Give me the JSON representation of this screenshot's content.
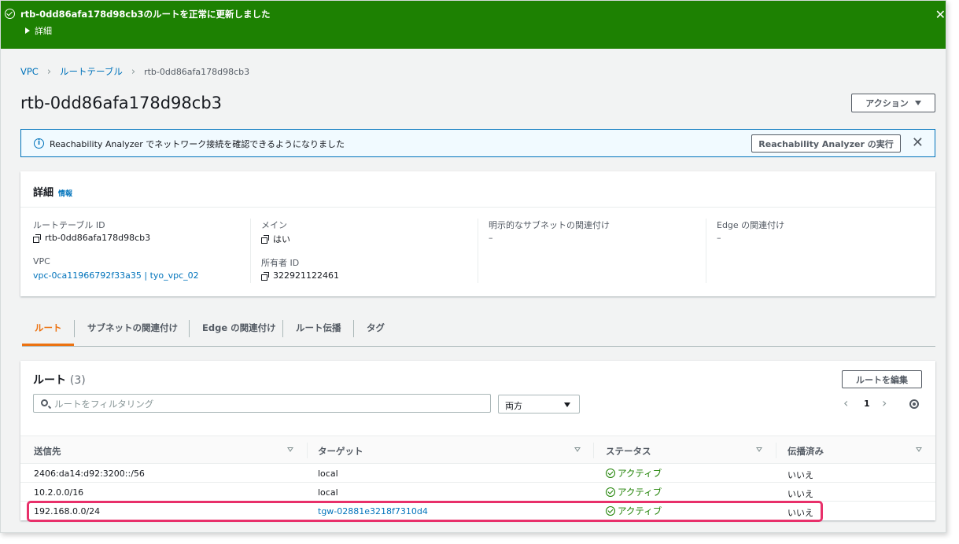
{
  "flash": {
    "message": "rtb-0dd86afa178d98cb3のルートを正常に更新しました",
    "details_label": "詳細",
    "close_glyph": "✕"
  },
  "breadcrumb": {
    "items": [
      "VPC",
      "ルートテーブル"
    ],
    "current": "rtb-0dd86afa178d98cb3"
  },
  "page": {
    "title": "rtb-0dd86afa178d98cb3",
    "actions_label": "アクション"
  },
  "reachability": {
    "message": "Reachability Analyzer でネットワーク接続を確認できるようになりました",
    "run_button": "Reachability Analyzer の実行"
  },
  "details": {
    "title": "詳細",
    "info_link": "情報",
    "fields": {
      "route_table_id_label": "ルートテーブル ID",
      "route_table_id": "rtb-0dd86afa178d98cb3",
      "vpc_label": "VPC",
      "vpc": "vpc-0ca11966792f33a35 | tyo_vpc_02",
      "main_label": "メイン",
      "main": "はい",
      "owner_label": "所有者 ID",
      "owner": "322921122461",
      "explicit_subnet_label": "明示的なサブネットの関連付け",
      "explicit_subnet": "–",
      "edge_label": "Edge の関連付け",
      "edge": "–"
    }
  },
  "tabs": [
    {
      "label": "ルート",
      "active": true
    },
    {
      "label": "サブネットの関連付け",
      "active": false
    },
    {
      "label": "Edge の関連付け",
      "active": false
    },
    {
      "label": "ルート伝播",
      "active": false
    },
    {
      "label": "タグ",
      "active": false
    }
  ],
  "routes": {
    "title": "ルート",
    "count": "(3)",
    "edit_button": "ルートを編集",
    "filter_placeholder": "ルートをフィルタリング",
    "direction_select": "両方",
    "page_number": "1",
    "columns": [
      "送信先",
      "ターゲット",
      "ステータス",
      "伝播済み"
    ],
    "rows": [
      {
        "destination": "2406:da14:d92:3200::/56",
        "target": "local",
        "target_link": false,
        "status": "アクティブ",
        "propagated": "いいえ"
      },
      {
        "destination": "10.2.0.0/16",
        "target": "local",
        "target_link": false,
        "status": "アクティブ",
        "propagated": "いいえ"
      },
      {
        "destination": "192.168.0.0/24",
        "target": "tgw-02881e3218f7310d4",
        "target_link": true,
        "status": "アクティブ",
        "propagated": "いいえ"
      }
    ]
  },
  "colors": {
    "success_green": "#1d8102",
    "link_blue": "#0073bb",
    "active_tab_orange": "#ec7211",
    "highlight_pink": "#e8306a"
  }
}
